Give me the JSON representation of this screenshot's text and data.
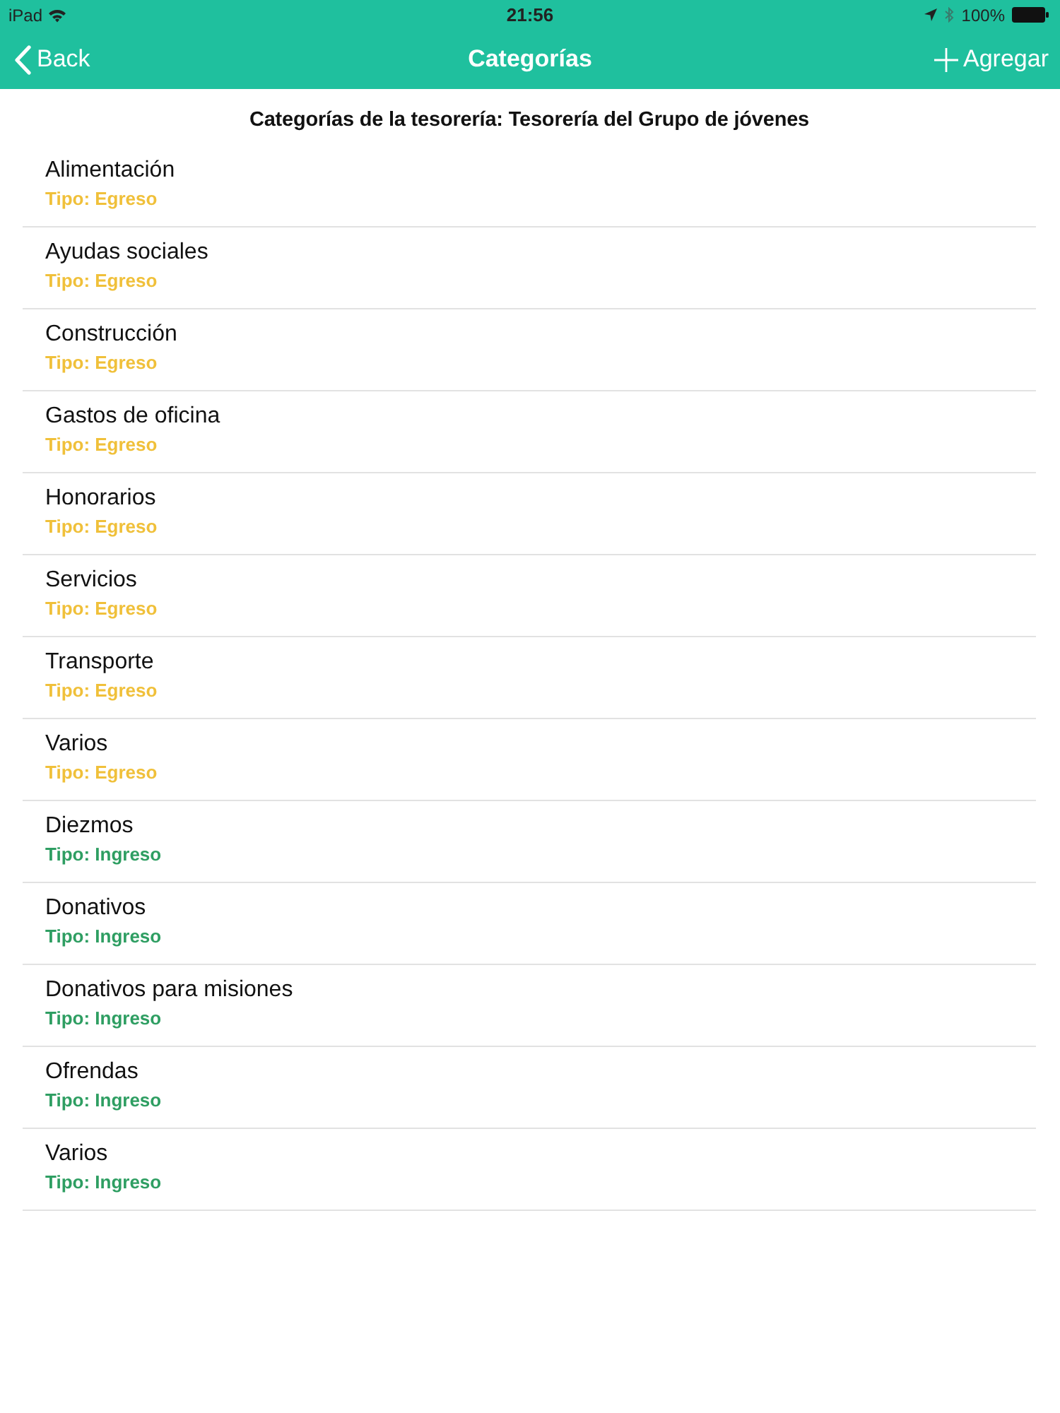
{
  "status_bar": {
    "device": "iPad",
    "time": "21:56",
    "battery": "100%"
  },
  "nav_bar": {
    "back": "Back",
    "title": "Categorías",
    "add": "Agregar"
  },
  "subtitle": "Categorías de la tesorería: Tesorería del Grupo de jóvenes",
  "categories": [
    {
      "name": "Alimentación",
      "type": "Tipo: Egreso",
      "color": "#f0c03a"
    },
    {
      "name": "Ayudas sociales",
      "type": "Tipo: Egreso",
      "color": "#f0c03a"
    },
    {
      "name": "Construcción",
      "type": "Tipo: Egreso",
      "color": "#f0c03a"
    },
    {
      "name": "Gastos de oficina",
      "type": "Tipo: Egreso",
      "color": "#f0c03a"
    },
    {
      "name": "Honorarios",
      "type": "Tipo: Egreso",
      "color": "#f0c03a"
    },
    {
      "name": "Servicios",
      "type": "Tipo: Egreso",
      "color": "#f0c03a"
    },
    {
      "name": "Transporte",
      "type": "Tipo: Egreso",
      "color": "#f0c03a"
    },
    {
      "name": "Varios",
      "type": "Tipo: Egreso",
      "color": "#f0c03a"
    },
    {
      "name": "Diezmos",
      "type": "Tipo: Ingreso",
      "color": "#2e9e62"
    },
    {
      "name": "Donativos",
      "type": "Tipo: Ingreso",
      "color": "#2e9e62"
    },
    {
      "name": "Donativos para misiones",
      "type": "Tipo: Ingreso",
      "color": "#2e9e62"
    },
    {
      "name": "Ofrendas",
      "type": "Tipo: Ingreso",
      "color": "#2e9e62"
    },
    {
      "name": "Varios",
      "type": "Tipo: Ingreso",
      "color": "#2e9e62"
    }
  ]
}
